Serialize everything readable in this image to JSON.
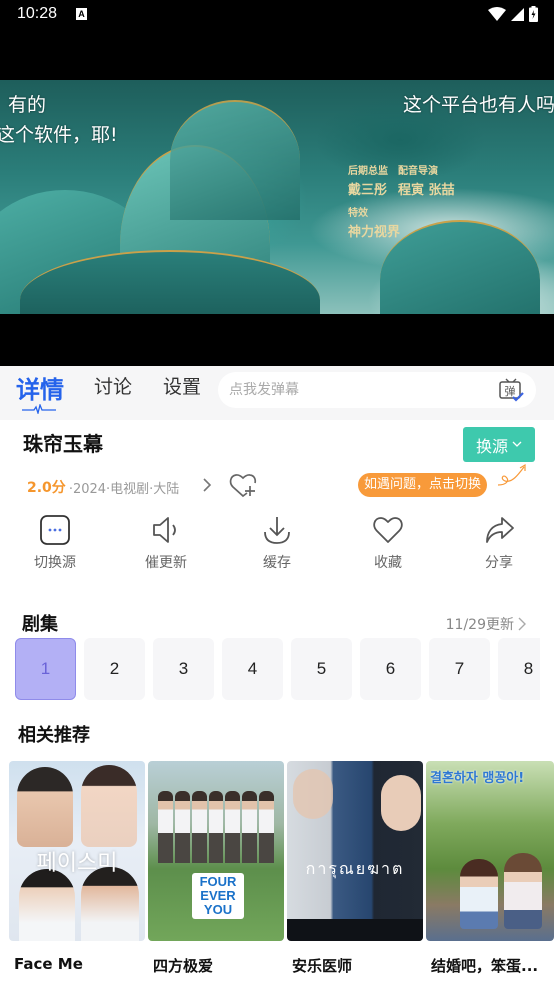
{
  "statusbar": {
    "time": "10:28",
    "notification_icon": "a-icon",
    "icons": [
      "wifi-icon",
      "signal-icon",
      "battery-charging-icon"
    ]
  },
  "video": {
    "danmaku": [
      {
        "text": "有的"
      },
      {
        "text": "这个软件，耶!"
      },
      {
        "text": "这个平台也有人吗"
      }
    ],
    "credits": [
      {
        "title": "后期总监",
        "name": "戴三彤"
      },
      {
        "title": "配音导演",
        "name": "程寅 张喆"
      },
      {
        "title": "特效",
        "name": "神力视界"
      }
    ]
  },
  "tabs": {
    "items": [
      {
        "label": "详情",
        "active": true
      },
      {
        "label": "讨论",
        "active": false
      },
      {
        "label": "设置",
        "active": false
      }
    ],
    "danmu_placeholder": "点我发弹幕",
    "danmu_button_icon": "danmaku-send-icon",
    "danmu_button_glyph": "弹"
  },
  "show": {
    "title": "珠帘玉幕",
    "switch_source_label": "换源",
    "score": "2.0分",
    "meta": "·2024·电视剧·大陆",
    "tip": "如遇问题，点击切换"
  },
  "actions": [
    {
      "label": "切换源",
      "icon": "switch-source-icon"
    },
    {
      "label": "催更新",
      "icon": "speaker-icon"
    },
    {
      "label": "缓存",
      "icon": "download-icon"
    },
    {
      "label": "收藏",
      "icon": "heart-icon"
    },
    {
      "label": "分享",
      "icon": "share-icon"
    }
  ],
  "episodes": {
    "title": "剧集",
    "update_text": "11/29更新",
    "selected": "1",
    "items": [
      "1",
      "2",
      "3",
      "4",
      "5",
      "6",
      "7",
      "8"
    ]
  },
  "recommend": {
    "title": "相关推荐",
    "items": [
      {
        "name": "Face Me",
        "poster_text": "페이스미"
      },
      {
        "name": "四方极爱",
        "poster_text": "FOUR EVER YOU"
      },
      {
        "name": "安乐医师",
        "poster_text": "การุณยฆาต"
      },
      {
        "name": "结婚吧，笨蛋...",
        "poster_text": "결혼하자 맹꽁아!"
      }
    ]
  }
}
